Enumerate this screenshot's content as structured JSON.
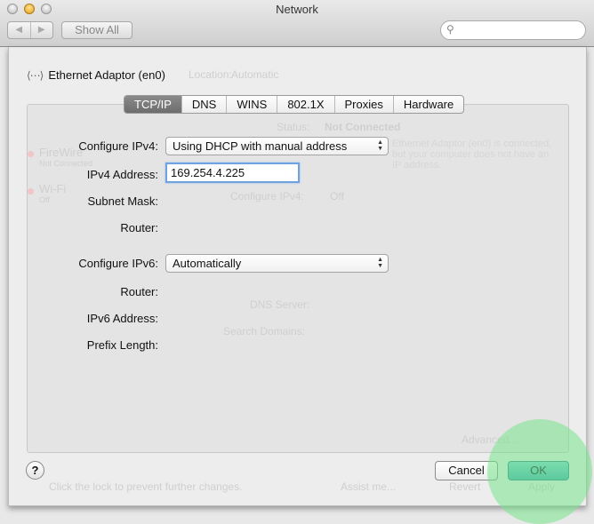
{
  "window": {
    "title": "Network",
    "show_all": "Show All",
    "back": "◀",
    "forward": "▶",
    "search_placeholder": ""
  },
  "background": {
    "location_label": "Location:",
    "location_value": "Automatic",
    "status_label": "Status:",
    "status_value": "Not Connected",
    "status_desc": "Ethernet Adaptor (en0) is connected, but your computer does not have an IP address.",
    "configure_ipv4_label": "Configure IPv4:",
    "configure_ipv4_value": "Off",
    "dns_server": "DNS Server:",
    "search_domains": "Search Domains:",
    "advanced": "Advanced...",
    "sidebar": [
      "FireWire",
      "Not Connected",
      "Wi-Fi",
      "Off"
    ],
    "lock_text": "Click the lock to prevent further changes.",
    "assist": "Assist me...",
    "revert": "Revert",
    "apply": "Apply"
  },
  "sheet": {
    "adapter": "Ethernet Adaptor (en0)",
    "tabs": [
      {
        "label": "TCP/IP",
        "selected": true
      },
      {
        "label": "DNS"
      },
      {
        "label": "WINS"
      },
      {
        "label": "802.1X"
      },
      {
        "label": "Proxies"
      },
      {
        "label": "Hardware"
      }
    ],
    "form": {
      "configure_ipv4_label": "Configure IPv4:",
      "configure_ipv4_value": "Using DHCP with manual address",
      "ipv4_address_label": "IPv4 Address:",
      "ipv4_address_value": "169.254.4.225",
      "subnet_mask_label": "Subnet Mask:",
      "router_label": "Router:",
      "configure_ipv6_label": "Configure IPv6:",
      "configure_ipv6_value": "Automatically",
      "router6_label": "Router:",
      "ipv6_address_label": "IPv6 Address:",
      "prefix_length_label": "Prefix Length:"
    },
    "help": "?",
    "cancel": "Cancel",
    "ok": "OK"
  },
  "colors": {
    "ok_button": "#3aa8b2",
    "highlight": "#78e68c",
    "field_focus": "#6fa2e0"
  }
}
